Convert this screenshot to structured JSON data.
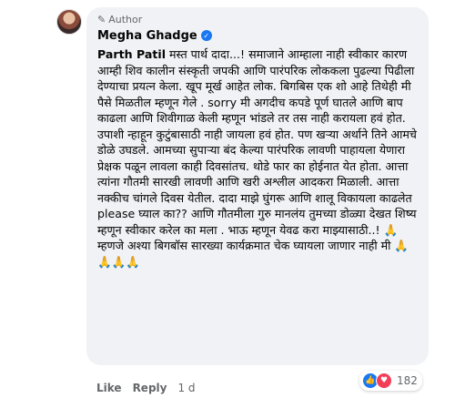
{
  "comment": {
    "badge": "Author",
    "author_name": "Megha Ghadge",
    "mention": "Parth Patil",
    "text": "मस्त पार्थ दादा...! समाजाने आम्हाला नाही स्वीकार कारण आम्ही शिव कालीन संस्कृती जपकी आणि पारंपरिक लोककला पुढल्या पिढीला देण्याचा प्रयत्न केला. खूप मूर्ख आहेत लोक. बिगबिस एक शो आहे तिथेही मी पैसे मिळतील म्हणून गेले . sorry मी अगदीच कपडे पूर्ण घातले आणि बाप काढला आणि शिवीगाळ केली म्हणून भांडले तर तस नाही करायला हवं होत. उपाशी न्हाहून कुटुंबासाठी नाही जायला हवं होत. पण खऱ्या अर्थाने तिने आमचे डोळे उघडले. आमच्या सुपाऱ्या बंद केल्या पारंपरिक लावणी पाहायला येणारा प्रेक्षक पळून लावला काही दिवसांतच. थोडे फार का होईनात येत होता. आत्ता त्यांना गौतमी सारखी लावणी आणि खरी अश्लील आदकरा मिळाली. आत्ता नक्कीच चांगले दिवस येतील. दादा माझे घुंगरू आणि शालू विकायला काढलेत please घ्याल का?? आणि गौतमीला गुरु मानलंय तुमच्या डोळ्या देखत शिष्य म्हणून स्वीकार करेल का मला . भाऊ म्हणून येवढ करा माझ्यासाठी..! 🙏 म्हणजे अश्या बिगबॉस सारख्या कार्यक्रमात चेक घ्यायला जाणार नाही मी 🙏🙏🙏🙏",
    "reaction_count": "182"
  },
  "actions": {
    "like": "Like",
    "reply": "Reply",
    "time": "1 d"
  },
  "icons": {
    "badge": "pencil-icon",
    "verified": "verified-check-icon",
    "reactions": [
      "like-reaction-icon",
      "love-reaction-icon"
    ]
  }
}
